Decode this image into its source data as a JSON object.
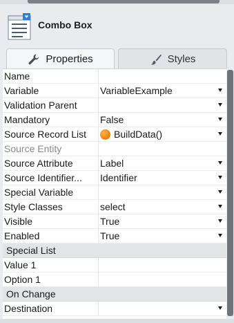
{
  "header": {
    "title": "Combo Box",
    "icon": "combo-box-icon"
  },
  "tabs": [
    {
      "label": "Properties",
      "icon": "wrench-icon",
      "active": true
    },
    {
      "label": "Styles",
      "icon": "brush-icon",
      "active": false
    }
  ],
  "properties": [
    {
      "name": "Name",
      "value": "",
      "dropdown": false
    },
    {
      "name": "Variable",
      "value": "VariableExample",
      "dropdown": true
    },
    {
      "name": "Validation Parent",
      "value": "",
      "dropdown": true
    },
    {
      "name": "Mandatory",
      "value": "False",
      "dropdown": true
    },
    {
      "name": "Source Record List",
      "value": "BuildData()",
      "dropdown": true,
      "icon": "orange-orb-icon"
    },
    {
      "name": "Source Entity",
      "value": "",
      "dropdown": false,
      "disabled": true
    },
    {
      "name": "Source Attribute",
      "value": "Label",
      "dropdown": true
    },
    {
      "name": "Source Identifier...",
      "value": "Identifier",
      "dropdown": true
    },
    {
      "name": "Special Variable",
      "value": "",
      "dropdown": true
    },
    {
      "name": "Style Classes",
      "value": "select",
      "dropdown": true
    },
    {
      "name": "Visible",
      "value": "True",
      "dropdown": true
    },
    {
      "name": "Enabled",
      "value": "True",
      "dropdown": true
    }
  ],
  "special_list": {
    "title": "Special List",
    "rows": [
      {
        "name": "Value 1",
        "value": ""
      },
      {
        "name": "Option 1",
        "value": ""
      }
    ]
  },
  "on_change": {
    "title": "On Change",
    "rows": [
      {
        "name": "Destination",
        "value": "",
        "dropdown": true
      }
    ]
  },
  "colors": {
    "orb": "#f08a0e",
    "section_bg": "#e3e4e6",
    "scroll_thumb": "#6f7277"
  }
}
